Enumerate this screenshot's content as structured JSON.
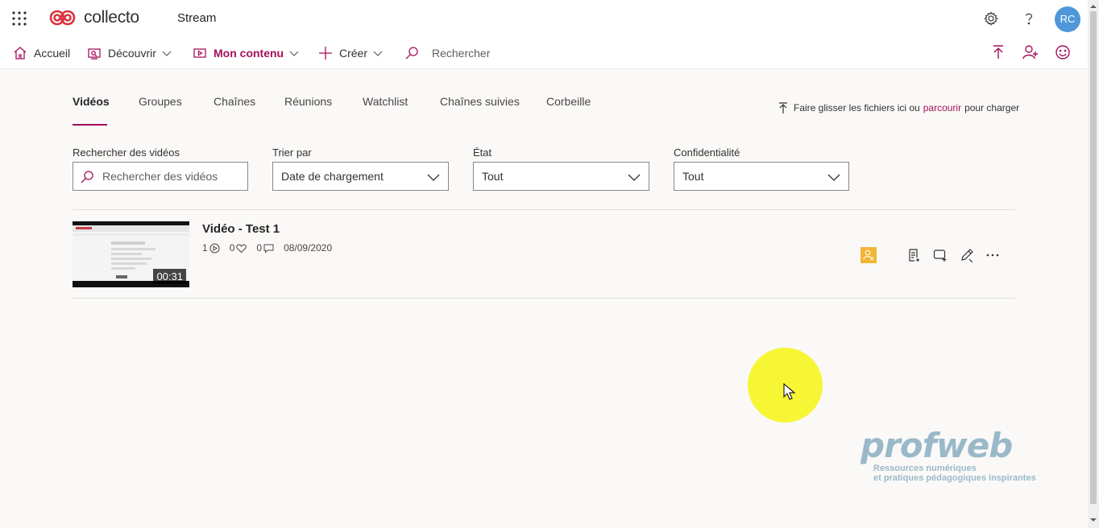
{
  "app": {
    "brand": "collecto",
    "title": "Stream",
    "avatar_initials": "RC",
    "brand_color": "#a4105c"
  },
  "topbar": {
    "icons": [
      "app-launcher-icon",
      "settings-icon",
      "help-icon"
    ]
  },
  "nav": {
    "home": "Accueil",
    "discover": "Découvrir",
    "my_content": "Mon contenu",
    "create": "Créer",
    "search_placeholder": "Rechercher",
    "right_icons": [
      "upload-icon",
      "invite-icon",
      "feedback-icon"
    ]
  },
  "tabs": {
    "videos": "Vidéos",
    "groups": "Groupes",
    "channels": "Chaînes",
    "meetings": "Réunions",
    "watchlist": "Watchlist",
    "followed": "Chaînes suivies",
    "trash": "Corbeille"
  },
  "upload": {
    "before": "Faire glisser les fichiers ici ou",
    "link": "parcourir",
    "after": "pour charger"
  },
  "filters": {
    "search_label": "Rechercher des vidéos",
    "search_placeholder": "Rechercher des vidéos",
    "sort_label": "Trier par",
    "sort_value": "Date de chargement",
    "state_label": "État",
    "state_value": "Tout",
    "privacy_label": "Confidentialité",
    "privacy_value": "Tout"
  },
  "videos": [
    {
      "title": "Vidéo - Test 1",
      "duration": "00:31",
      "views": "1",
      "likes": "0",
      "comments": "0",
      "date": "08/09/2020",
      "badge_color": "#f2b636"
    }
  ],
  "watermark": {
    "logo": "profweb",
    "line1": "Ressources numériques",
    "line2": "et pratiques pédagogiques inspirantes"
  }
}
